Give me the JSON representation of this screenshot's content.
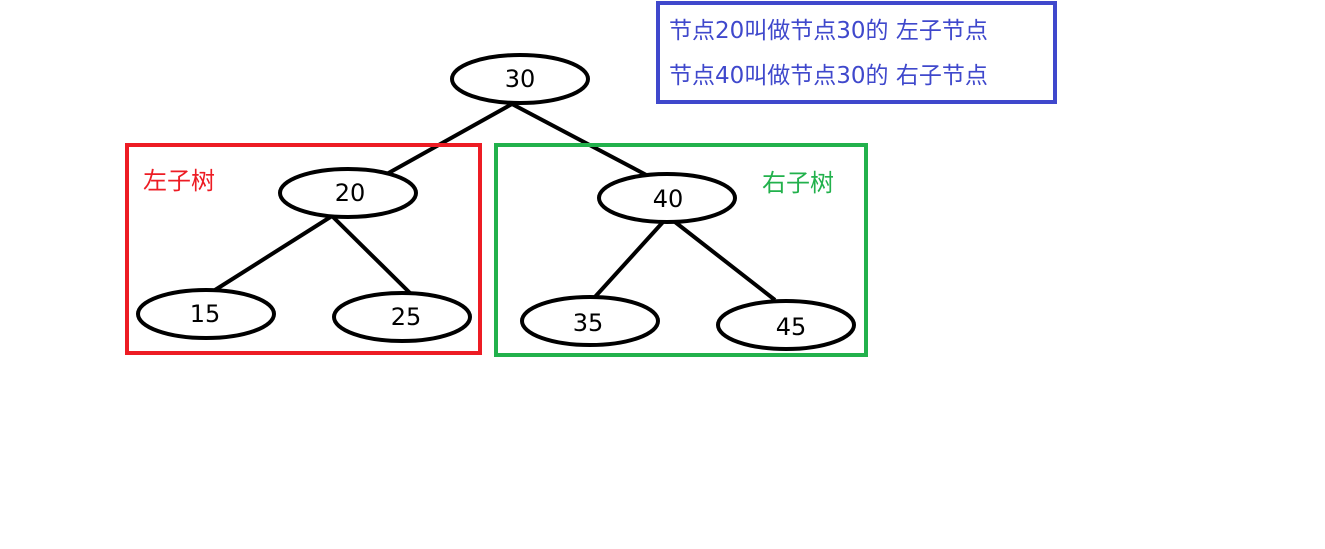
{
  "tree": {
    "nodes": [
      {
        "id": "n30",
        "label": "30"
      },
      {
        "id": "n20",
        "label": "20"
      },
      {
        "id": "n40",
        "label": "40"
      },
      {
        "id": "n15",
        "label": "15"
      },
      {
        "id": "n25",
        "label": "25"
      },
      {
        "id": "n35",
        "label": "35"
      },
      {
        "id": "n45",
        "label": "45"
      }
    ],
    "edges": [
      {
        "from": "n30",
        "to": "n20"
      },
      {
        "from": "n30",
        "to": "n40"
      },
      {
        "from": "n20",
        "to": "n15"
      },
      {
        "from": "n20",
        "to": "n25"
      },
      {
        "from": "n40",
        "to": "n35"
      },
      {
        "from": "n40",
        "to": "n45"
      }
    ]
  },
  "regions": {
    "left_subtree": {
      "label": "左子树",
      "color": "#ed1c24"
    },
    "right_subtree": {
      "label": "右子树",
      "color": "#22b14c"
    }
  },
  "note": {
    "lines": [
      "节点20叫做节点30的 左子节点",
      "节点40叫做节点30的 右子节点"
    ],
    "color": "#3f48cc"
  }
}
